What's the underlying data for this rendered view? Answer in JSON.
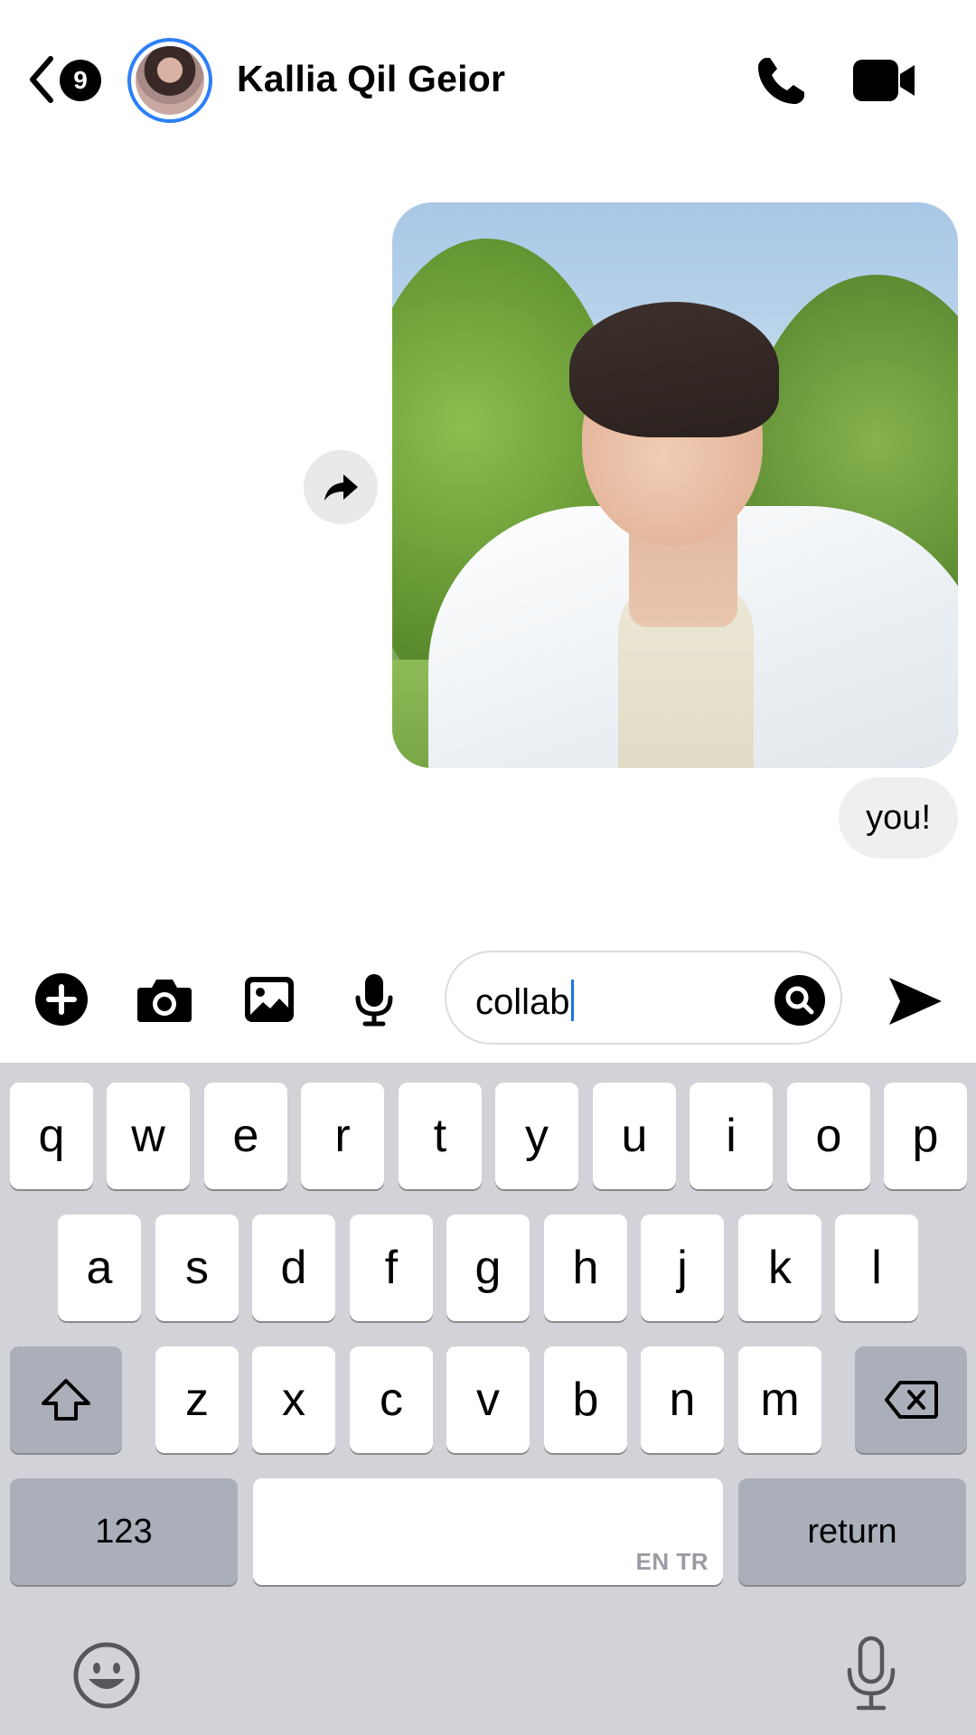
{
  "header": {
    "back_badge": "9",
    "contact_name": "Kallia Qil Geior",
    "icons": [
      "chevron-left-icon",
      "phone-icon",
      "video-camera-icon"
    ],
    "avatar_ring_color": "#2d7ff9"
  },
  "messages": [
    {
      "type": "photo",
      "sender": "self"
    },
    {
      "type": "text",
      "sender": "self",
      "text": "you!"
    }
  ],
  "composer": {
    "input_value": "collab",
    "icons": [
      "add-icon",
      "camera-icon",
      "gallery-icon",
      "microphone-icon",
      "search-icon",
      "send-icon"
    ]
  },
  "keyboard": {
    "row1": [
      "q",
      "w",
      "e",
      "r",
      "t",
      "y",
      "u",
      "i",
      "o",
      "p"
    ],
    "row2": [
      "a",
      "s",
      "d",
      "f",
      "g",
      "h",
      "j",
      "k",
      "l"
    ],
    "row3": [
      "z",
      "x",
      "c",
      "v",
      "b",
      "n",
      "m"
    ],
    "numbers_label": "123",
    "return_label": "return",
    "space_lang": "EN TR",
    "icons": [
      "shift-icon",
      "backspace-icon",
      "emoji-icon",
      "dictation-mic-icon"
    ]
  }
}
